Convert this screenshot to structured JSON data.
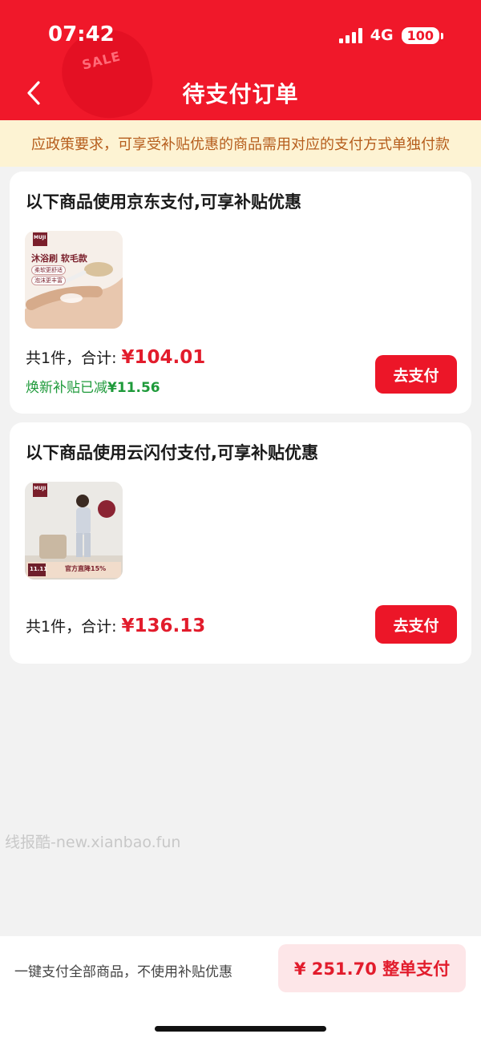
{
  "status_bar": {
    "time": "07:42",
    "network": "4G",
    "battery": "100"
  },
  "header": {
    "title": "待支付订单",
    "decor_tag": "SALE"
  },
  "notice": "应政策要求，可享受补贴优惠的商品需用对应的支付方式单独付款",
  "orders": [
    {
      "title": "以下商品使用京东支付,可享补贴优惠",
      "thumb": {
        "brand": "MUJI",
        "name": "沐浴刷 软毛款",
        "tags": [
          "柔软更舒适",
          "泡沫更丰富"
        ]
      },
      "total_label": "共1件，合计:",
      "amount": "¥104.01",
      "subsidy": "焕新补贴已减",
      "subsidy_amount": "¥11.56",
      "pay_label": "去支付"
    },
    {
      "title": "以下商品使用云闪付支付,可享补贴优惠",
      "thumb": {
        "brand": "MUJI",
        "banner": "官方直降15%",
        "date": "11.11"
      },
      "total_label": "共1件，合计:",
      "amount": "¥136.13",
      "pay_label": "去支付"
    }
  ],
  "watermark": "线报酷-new.xianbao.fun",
  "bottom": {
    "note": "一键支付全部商品，不使用补贴优惠",
    "pay_all_label": "¥ 251.70 整单支付"
  },
  "colors": {
    "brand_red": "#f0182a",
    "price_red": "#e21c2c",
    "subsidy_green": "#1e9a3a",
    "notice_bg": "#fdf3d3"
  }
}
